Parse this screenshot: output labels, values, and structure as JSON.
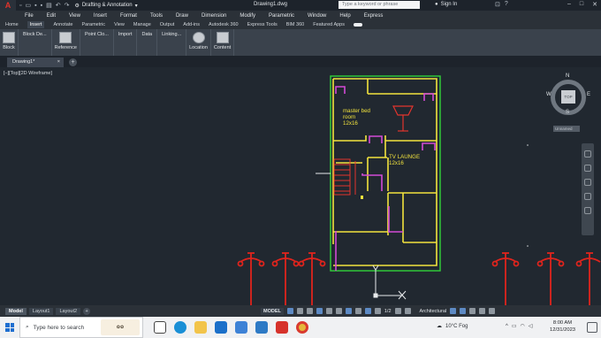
{
  "titlebar": {
    "app_logo": "A",
    "workspace": "Drafting & Annotation",
    "document_title": "Drawing1.dwg",
    "search_placeholder": "Type a keyword or phrase",
    "signin": "Sign In",
    "icons": [
      "new-icon",
      "open-icon",
      "save-icon",
      "saveas-icon",
      "plot-icon",
      "undo-icon",
      "redo-icon",
      "search-icon",
      "user-icon",
      "cart-icon",
      "help-icon"
    ]
  },
  "menubar": {
    "items": [
      "File",
      "Edit",
      "View",
      "Insert",
      "Format",
      "Tools",
      "Draw",
      "Dimension",
      "Modify",
      "Parametric",
      "Window",
      "Help",
      "Express"
    ]
  },
  "ribbon_tabs": {
    "items": [
      "Home",
      "Insert",
      "Annotate",
      "Parametric",
      "View",
      "Manage",
      "Output",
      "Add-ins",
      "Autodesk 360",
      "Express Tools",
      "BIM 360",
      "Featured Apps"
    ],
    "active": "Insert"
  },
  "ribbon": {
    "block": "Block",
    "block_definition": "Block De...",
    "reference": "Reference",
    "point_cloud": "Point Clo...",
    "import": "Import",
    "data": "Data",
    "linking": "Linking...",
    "location": "Location",
    "content": "Content"
  },
  "doc_tabs": {
    "active": "Drawing1*",
    "close_icon": "close-icon",
    "new_tab": "+"
  },
  "viewport": {
    "label": "[–][Top][2D Wireframe]"
  },
  "plan": {
    "room1_line1": "master bed",
    "room1_line2": "room",
    "room1_line3": "12x16",
    "room2_line1": "TV LAUNGE",
    "room2_line2": "12x16"
  },
  "viewcube": {
    "n": "N",
    "s": "S",
    "e": "E",
    "w": "W",
    "face": "TOP",
    "ucs": "Unnamed"
  },
  "layout_tabs": {
    "items": [
      "Model",
      "Layout1",
      "Layout2"
    ],
    "active": "Model",
    "new_tab": "+"
  },
  "statusbar": {
    "model": "MODEL",
    "scale": "1/2",
    "units": "Architectural"
  },
  "taskbar": {
    "search_placeholder": "Type here to search",
    "weather": "10°C Fog",
    "time": "8:00 AM",
    "date": "12/31/2023",
    "icons": [
      "windows-start-icon",
      "search-icon",
      "task-view-icon",
      "edge-icon",
      "explorer-icon",
      "mail-icon",
      "store-icon",
      "photos-icon",
      "autocad-icon",
      "chrome-icon"
    ]
  },
  "colors": {
    "canvas_bg": "#212830",
    "plan_outer": "#32d23a",
    "plan_walls": "#f2e33d",
    "plan_doors": "#d24ad6",
    "plan_fixture": "#e2342d",
    "light_poles": "#e0241d"
  }
}
